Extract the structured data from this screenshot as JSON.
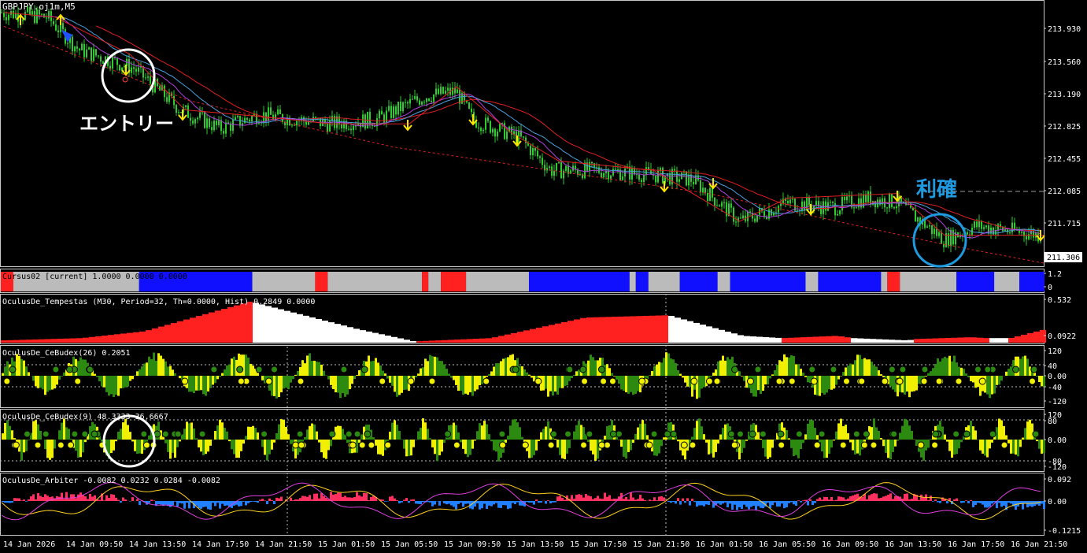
{
  "colors": {
    "background": "#000000",
    "grid_line": "#c8c8c8",
    "candle": "#2ecc2e",
    "ma_red": "#e02020",
    "ma_blue": "#4aa0e0",
    "ma_purple": "#b040e0",
    "arrow_sell": "#ffe600",
    "arrow_buy": "#2050ff",
    "osc_green": "#2d8a10",
    "osc_yellow": "#f0f000",
    "cursus_red": "#ff2020",
    "cursus_blue": "#1010ff",
    "cursus_gray": "#bbbbbb",
    "annotation_white": "#ffffff",
    "annotation_blue": "#1e9be0"
  },
  "main_chart": {
    "symbol_label": "GBPJPY.oj1m,M5",
    "price_axis": [
      "213.930",
      "213.560",
      "213.190",
      "212.825",
      "212.455",
      "212.085",
      "211.715"
    ],
    "current_price": "211.306",
    "price_range": [
      211.3,
      214.1
    ],
    "annotations": {
      "entry_text": "エントリー",
      "profit_text": "利確"
    }
  },
  "cursus_panel": {
    "title": "Cursus02 [current] 1.0000 0.0000 0.0000",
    "axis": [
      "1.2",
      "0"
    ],
    "segments": [
      {
        "color": "red",
        "start": 0,
        "end": 2
      },
      {
        "color": "gray",
        "start": 2,
        "end": 22
      },
      {
        "color": "blue",
        "start": 22,
        "end": 40
      },
      {
        "color": "gray",
        "start": 40,
        "end": 50
      },
      {
        "color": "red",
        "start": 50,
        "end": 52
      },
      {
        "color": "gray",
        "start": 52,
        "end": 67
      },
      {
        "color": "red",
        "start": 67,
        "end": 68
      },
      {
        "color": "gray",
        "start": 68,
        "end": 70
      },
      {
        "color": "red",
        "start": 70,
        "end": 74
      },
      {
        "color": "gray",
        "start": 74,
        "end": 84
      },
      {
        "color": "blue",
        "start": 84,
        "end": 100
      },
      {
        "color": "gray",
        "start": 100,
        "end": 101
      },
      {
        "color": "blue",
        "start": 101,
        "end": 103
      },
      {
        "color": "gray",
        "start": 103,
        "end": 108
      },
      {
        "color": "blue",
        "start": 108,
        "end": 114
      },
      {
        "color": "gray",
        "start": 114,
        "end": 116
      },
      {
        "color": "blue",
        "start": 116,
        "end": 128
      },
      {
        "color": "gray",
        "start": 128,
        "end": 130
      },
      {
        "color": "blue",
        "start": 130,
        "end": 140
      },
      {
        "color": "gray",
        "start": 140,
        "end": 141
      },
      {
        "color": "red",
        "start": 141,
        "end": 143
      },
      {
        "color": "gray",
        "start": 143,
        "end": 152
      },
      {
        "color": "blue",
        "start": 152,
        "end": 158
      },
      {
        "color": "gray",
        "start": 158,
        "end": 162
      },
      {
        "color": "blue",
        "start": 162,
        "end": 166
      }
    ]
  },
  "tempestas_panel": {
    "title": "OculusDe_Tempestas (M30, Period=32, Th=0.0000, Hist) 0.2849 0.0000",
    "axis": [
      "0.532",
      "0.0922"
    ]
  },
  "cebudex26_panel": {
    "title": "OculusDe_CeBudex(26) 0.2051",
    "axis": [
      "120",
      "40",
      "0.00",
      "-40",
      "-120"
    ]
  },
  "cebudex9_panel": {
    "title": "OculusDe_CeBudex(9) 48.3333 36.6667",
    "axis": [
      "120",
      "80",
      "0.00",
      "-80",
      "-120"
    ]
  },
  "arbiter_panel": {
    "title": "OculusDe_Arbiter -0.0082 0.0232 0.0284 -0.0082",
    "axis": [
      "0.092",
      "0.00",
      "-0.1215"
    ]
  },
  "time_axis": [
    "14 Jan 2026",
    "14 Jan 09:50",
    "14 Jan 13:50",
    "14 Jan 17:50",
    "14 Jan 21:50",
    "15 Jan 01:50",
    "15 Jan 05:50",
    "15 Jan 09:50",
    "15 Jan 13:50",
    "15 Jan 17:50",
    "15 Jan 21:50",
    "16 Jan 01:50",
    "16 Jan 05:50",
    "16 Jan 09:50",
    "16 Jan 13:50",
    "16 Jan 17:50",
    "16 Jan 21:50"
  ]
}
